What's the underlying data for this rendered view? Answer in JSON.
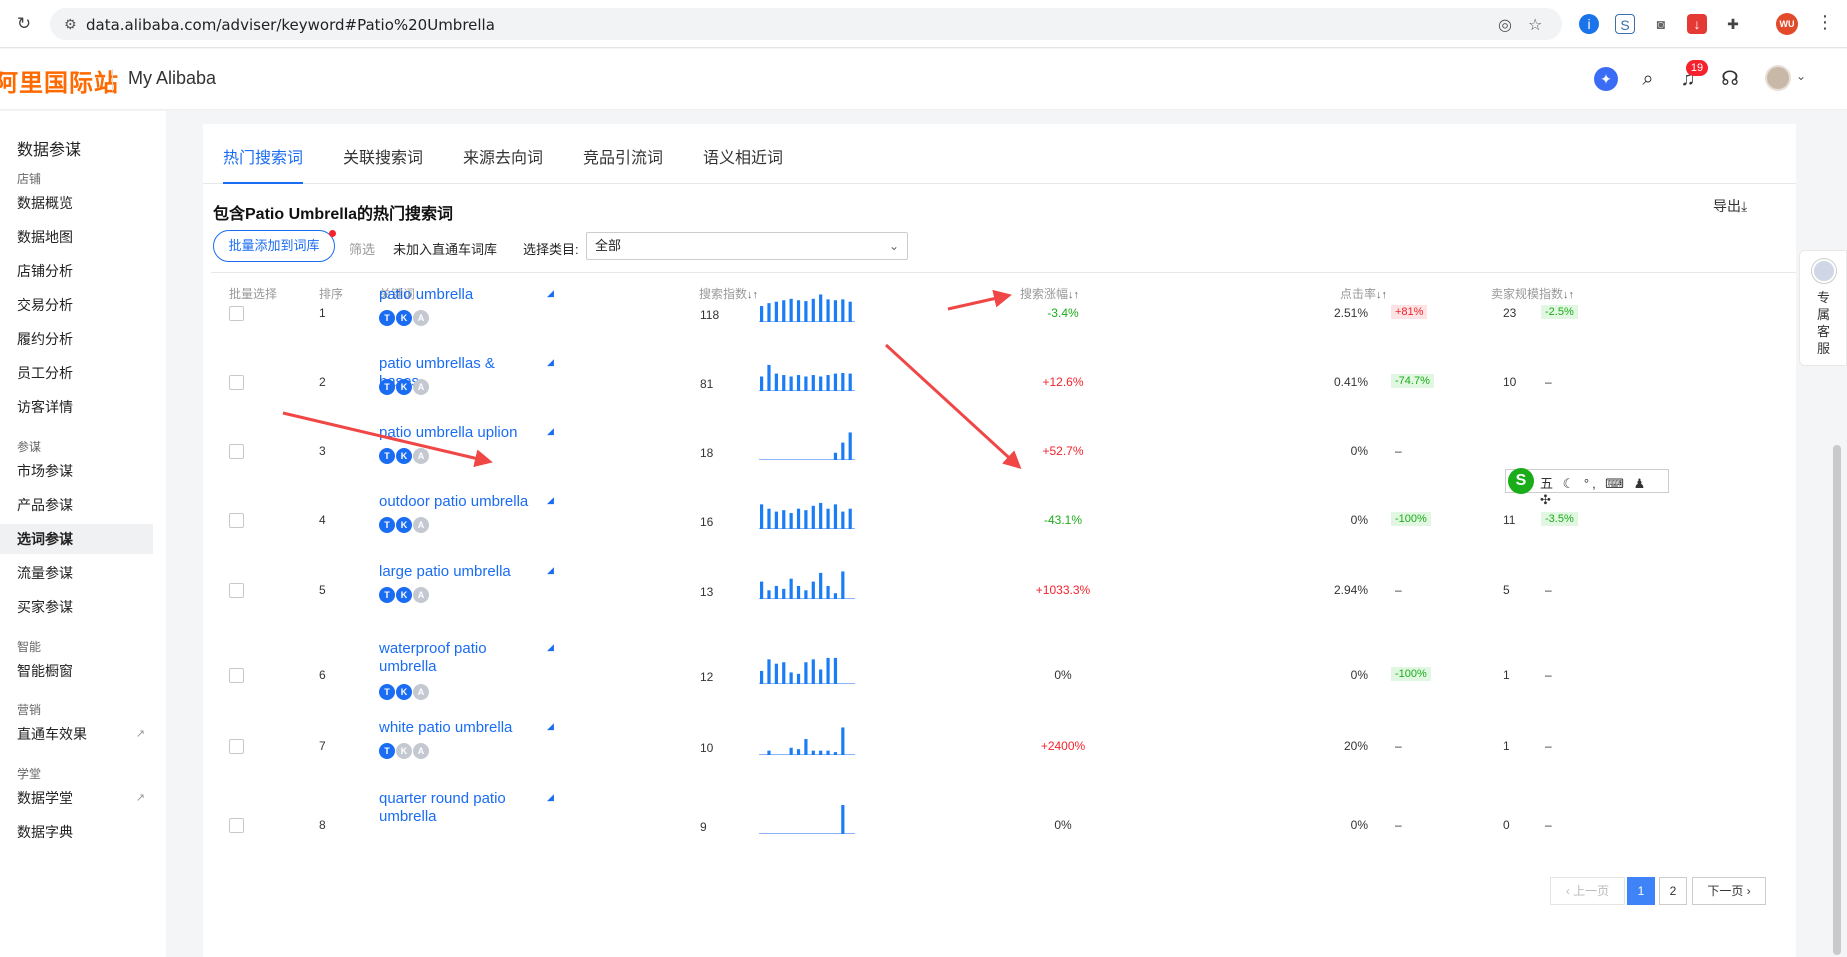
{
  "browser": {
    "url": "data.alibaba.com/adviser/keyword#Patio%20Umbrella",
    "profile_initials": "WU"
  },
  "header": {
    "logo": "阿里国际站",
    "title": "My Alibaba",
    "notification_count": "19"
  },
  "sidebar": {
    "title": "数据参谋",
    "groups": [
      {
        "label": "店铺",
        "items": [
          "数据概览",
          "数据地图",
          "店铺分析",
          "交易分析",
          "履约分析",
          "员工分析",
          "访客详情"
        ]
      },
      {
        "label": "参谋",
        "items": [
          "市场参谋",
          "产品参谋",
          "选词参谋",
          "流量参谋",
          "买家参谋"
        ]
      },
      {
        "label": "智能",
        "items": [
          "智能橱窗"
        ]
      },
      {
        "label": "营销",
        "items": [
          "直通车效果"
        ]
      },
      {
        "label": "学堂",
        "items": [
          "数据学堂",
          "数据字典"
        ]
      }
    ],
    "active_item": "选词参谋"
  },
  "tabs": [
    "热门搜索词",
    "关联搜索词",
    "来源去向词",
    "竞品引流词",
    "语义相近词"
  ],
  "active_tab": "热门搜索词",
  "section": {
    "title": "包含Patio Umbrella的热门搜索词",
    "export": "导出⤓"
  },
  "toolbar": {
    "batch_add": "批量添加到词库",
    "filter_label": "筛选",
    "filter_value": "未加入直通车词库",
    "category_label": "选择类目:",
    "category_value": "全部"
  },
  "columns": {
    "select": "批量选择",
    "rank": "排序",
    "keyword": "关键词",
    "search_index": "搜索指数",
    "growth": "搜索涨幅",
    "ctr": "点击率",
    "seller_index": "卖家规模指数"
  },
  "rows": [
    {
      "rank": "1",
      "keyword": "patio umbrella",
      "badges": [
        "T",
        "K",
        "A"
      ],
      "active_badges": [
        true,
        true,
        false
      ],
      "search_index": "118",
      "trend": [
        0.55,
        0.65,
        0.7,
        0.75,
        0.8,
        0.75,
        0.72,
        0.8,
        0.95,
        0.78,
        0.75,
        0.78,
        0.7
      ],
      "growth": "-3.4%",
      "growth_dir": "down",
      "ctr": "2.51%",
      "ctr_change": "+81%",
      "ctr_change_dir": "up",
      "seller_index": "23",
      "seller_change": "-2.5%",
      "seller_change_dir": "down"
    },
    {
      "rank": "2",
      "keyword": "patio umbrellas & bases",
      "badges": [
        "T",
        "K",
        "A"
      ],
      "active_badges": [
        true,
        true,
        false
      ],
      "search_index": "81",
      "trend": [
        0.5,
        0.9,
        0.6,
        0.55,
        0.5,
        0.55,
        0.5,
        0.55,
        0.5,
        0.55,
        0.6,
        0.62,
        0.6
      ],
      "growth": "+12.6%",
      "growth_dir": "up",
      "ctr": "0.41%",
      "ctr_change": "-74.7%",
      "ctr_change_dir": "down",
      "seller_index": "10",
      "seller_change": "–",
      "seller_change_dir": "none"
    },
    {
      "rank": "3",
      "keyword": "patio umbrella uplion",
      "badges": [
        "T",
        "K",
        "A"
      ],
      "active_badges": [
        true,
        true,
        false
      ],
      "search_index": "18",
      "trend": [
        0,
        0,
        0,
        0,
        0,
        0,
        0,
        0,
        0,
        0,
        0.25,
        0.6,
        0.95
      ],
      "growth": "+52.7%",
      "growth_dir": "up",
      "ctr": "0%",
      "ctr_change": "–",
      "ctr_change_dir": "none",
      "seller_index": "",
      "seller_change": "",
      "seller_change_dir": "none"
    },
    {
      "rank": "4",
      "keyword": "outdoor patio umbrella",
      "badges": [
        "T",
        "K",
        "A"
      ],
      "active_badges": [
        true,
        true,
        false
      ],
      "search_index": "16",
      "trend": [
        0.85,
        0.7,
        0.6,
        0.65,
        0.55,
        0.7,
        0.65,
        0.8,
        0.9,
        0.7,
        0.85,
        0.6,
        0.7
      ],
      "growth": "-43.1%",
      "growth_dir": "down",
      "ctr": "0%",
      "ctr_change": "-100%",
      "ctr_change_dir": "down",
      "seller_index": "11",
      "seller_change": "-3.5%",
      "seller_change_dir": "down"
    },
    {
      "rank": "5",
      "keyword": "large patio umbrella",
      "badges": [
        "T",
        "K",
        "A"
      ],
      "active_badges": [
        true,
        true,
        false
      ],
      "search_index": "13",
      "trend": [
        0.6,
        0.3,
        0.45,
        0.35,
        0.7,
        0.45,
        0.3,
        0.6,
        0.9,
        0.45,
        0.2,
        0.95
      ],
      "growth": "+1033.3%",
      "growth_dir": "up",
      "ctr": "2.94%",
      "ctr_change": "–",
      "ctr_change_dir": "none",
      "seller_index": "5",
      "seller_change": "–",
      "seller_change_dir": "none"
    },
    {
      "rank": "6",
      "keyword": "waterproof patio umbrella",
      "badges": [
        "T",
        "K",
        "A"
      ],
      "active_badges": [
        true,
        true,
        false
      ],
      "search_index": "12",
      "trend": [
        0.45,
        0.85,
        0.7,
        0.75,
        0.4,
        0.35,
        0.75,
        0.85,
        0.5,
        0.9,
        0.9
      ],
      "growth": "0%",
      "growth_dir": "none",
      "ctr": "0%",
      "ctr_change": "-100%",
      "ctr_change_dir": "down",
      "seller_index": "1",
      "seller_change": "–",
      "seller_change_dir": "none"
    },
    {
      "rank": "7",
      "keyword": "white patio umbrella",
      "badges": [
        "T",
        "K",
        "A"
      ],
      "active_badges": [
        true,
        false,
        false
      ],
      "search_index": "10",
      "trend": [
        0,
        0.15,
        0,
        0,
        0.25,
        0.2,
        0.55,
        0.15,
        0.15,
        0.15,
        0.1,
        0.95
      ],
      "growth": "+2400%",
      "growth_dir": "up",
      "ctr": "20%",
      "ctr_change": "–",
      "ctr_change_dir": "none",
      "seller_index": "1",
      "seller_change": "–",
      "seller_change_dir": "none"
    },
    {
      "rank": "8",
      "keyword": "quarter round patio umbrella",
      "badges": [],
      "active_badges": [],
      "search_index": "9",
      "trend": [
        0,
        0,
        0,
        0,
        0,
        0,
        0,
        0,
        0,
        0,
        0,
        1
      ],
      "growth": "0%",
      "growth_dir": "none",
      "ctr": "0%",
      "ctr_change": "–",
      "ctr_change_dir": "none",
      "seller_index": "0",
      "seller_change": "–",
      "seller_change_dir": "none"
    }
  ],
  "pagination": {
    "prev": "上一页",
    "pages": [
      "1",
      "2"
    ],
    "current": "1",
    "next": "下一页"
  },
  "ime": {
    "logo": "S",
    "text": "五 ☾ °, ⌨ ♟ ✣"
  },
  "service": {
    "label": "专属客服"
  },
  "colors": {
    "brand": "#ff6a00",
    "link": "#1a6cf3",
    "up": "#f5222d",
    "down": "#1aad19",
    "annotation": "#f04646"
  }
}
